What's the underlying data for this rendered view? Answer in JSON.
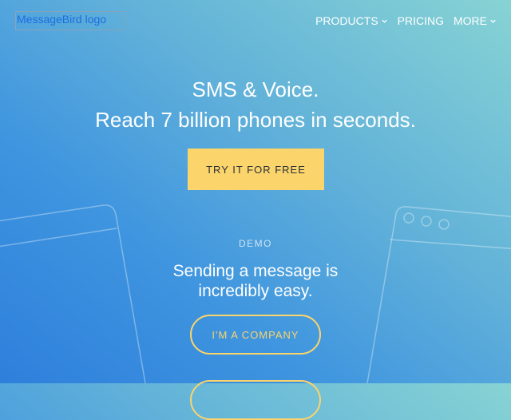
{
  "logo": {
    "alt": "MessageBird logo"
  },
  "nav": {
    "items": [
      {
        "label": "PRODUCTS",
        "has_dropdown": true
      },
      {
        "label": "PRICING",
        "has_dropdown": false
      },
      {
        "label": "MORE",
        "has_dropdown": true
      }
    ]
  },
  "hero": {
    "title": "SMS & Voice.",
    "subtitle": "Reach 7 billion phones in seconds.",
    "cta_label": "TRY IT FOR FREE"
  },
  "demo": {
    "label": "DEMO",
    "title_line1": "Sending a message is",
    "title_line2": "incredibly easy.",
    "company_button": "I'M A COMPANY"
  },
  "colors": {
    "accent": "#fbd46b",
    "gradient_start": "#2e7fdc",
    "gradient_end": "#87d3d4"
  }
}
